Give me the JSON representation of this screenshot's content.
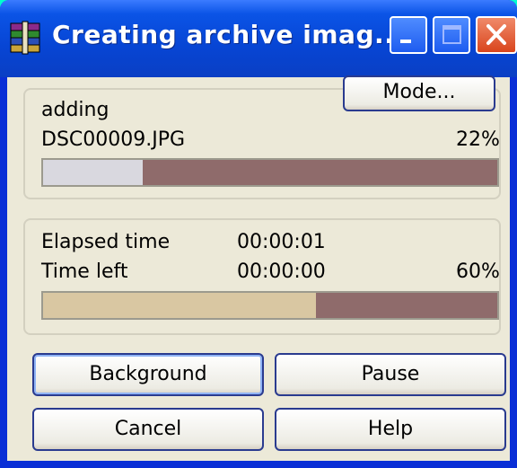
{
  "window": {
    "title": "Creating archive imag...",
    "controls": {
      "minimize": "minimize",
      "maximize": "maximize",
      "close": "close"
    }
  },
  "progress_group": {
    "action_label": "adding",
    "file_name": "DSC00009.JPG",
    "file_percent": "22%",
    "file_progress": 0.22,
    "mode_button": "Mode..."
  },
  "time_group": {
    "elapsed_label": "Elapsed time",
    "elapsed_value": "00:00:01",
    "left_label": "Time left",
    "left_value": "00:00:00",
    "total_percent": "60%",
    "total_progress": 0.6
  },
  "buttons": {
    "background": "Background",
    "pause": "Pause",
    "cancel": "Cancel",
    "help": "Help"
  },
  "colors": {
    "title_bar": "#0b54e6",
    "client_bg": "#ece9d8",
    "file_bar_fill": "#d9d8df",
    "total_bar_fill": "#d9c7a2",
    "bar_track": "#8f6b6b"
  }
}
